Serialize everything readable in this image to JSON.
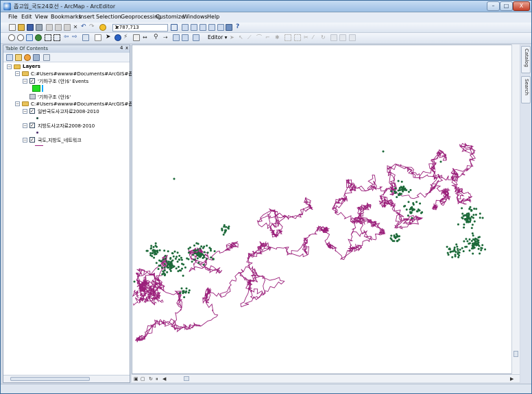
{
  "window": {
    "title": "좁고임_국도24호선 - ArcMap - ArcEditor",
    "minimize_label": "–",
    "maximize_label": "□",
    "close_label": "X"
  },
  "menu": [
    "File",
    "Edit",
    "View",
    "Bookmarks",
    "Insert",
    "Selection",
    "Geoprocessing",
    "Customize",
    "Windows",
    "Help"
  ],
  "toolbar": {
    "scale_value": "1:787,713",
    "editor_label": "Editor ▾"
  },
  "toc": {
    "title": "Table Of Contents",
    "pin": "4",
    "close": "x",
    "layers_label": "Layers",
    "groups": [
      {
        "path": "C:#Users#wwww#Documents#ArcGIS#좁고임#",
        "layers": [
          {
            "name": "'기하구조 (안)$' Events",
            "checked": true
          },
          {
            "name": "'기하구조 (안)$'",
            "checked": false
          }
        ]
      },
      {
        "path": "C:#Users#wwww#Documents#ArcGIS#좁고임",
        "layers": [
          {
            "name": "일반국도사고자료2008-2010",
            "checked": true
          },
          {
            "name": "지방도사고자료2008-2010",
            "checked": true
          },
          {
            "name": "국도,지방도_네트워크",
            "checked": true
          }
        ]
      }
    ]
  },
  "side_tabs": [
    "Catalog",
    "Search"
  ],
  "colors": {
    "road_network": "#9a1f7a",
    "accident_points": "#1d6a3a",
    "events_swatch": "#22dd22",
    "events_bar": "#00aaff"
  }
}
